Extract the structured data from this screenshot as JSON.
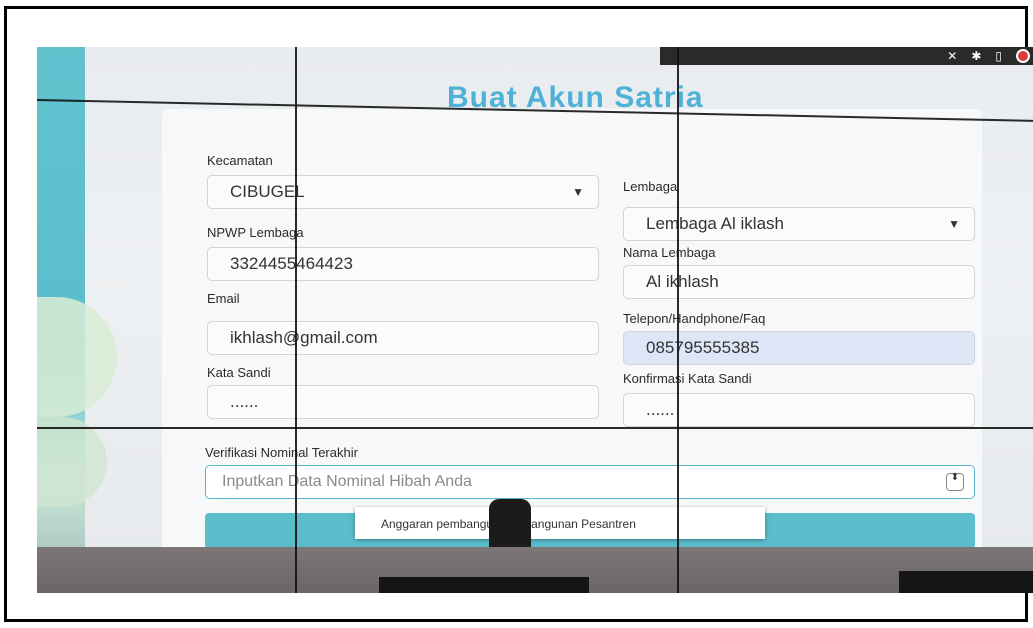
{
  "page": {
    "title": "Buat Akun Satria"
  },
  "form": {
    "kecamatan": {
      "label": "Kecamatan",
      "value": "CIBUGEL"
    },
    "lembaga": {
      "label": "Lembaga",
      "value": "Lembaga Al iklash"
    },
    "npwp": {
      "label": "NPWP Lembaga",
      "value": "3324455464423"
    },
    "nama_lembaga": {
      "label": "Nama Lembaga",
      "value": "Al ikhlash"
    },
    "email": {
      "label": "Email",
      "value": "ikhlash@gmail.com"
    },
    "telepon": {
      "label": "Telepon/Handphone/Faq",
      "value": "085795555385"
    },
    "kata_sandi": {
      "label": "Kata Sandi",
      "value": "......"
    },
    "konfirmasi": {
      "label": "Konfirmasi Kata Sandi",
      "value": "......"
    },
    "nominal": {
      "label": "Verifikasi Nominal Terakhir",
      "placeholder": "Inputkan Data Nominal Hibah Anda"
    }
  },
  "tooltip": {
    "text": "Anggaran pembangunaan Bangunan Pesantren"
  },
  "icons": [
    "chevron-down-icon",
    "spinner-icon",
    "status-dot-icon"
  ],
  "colors": {
    "accent": "#5bbccb",
    "title": "#4fb1d6",
    "highlight_field": "#dde6f6"
  }
}
